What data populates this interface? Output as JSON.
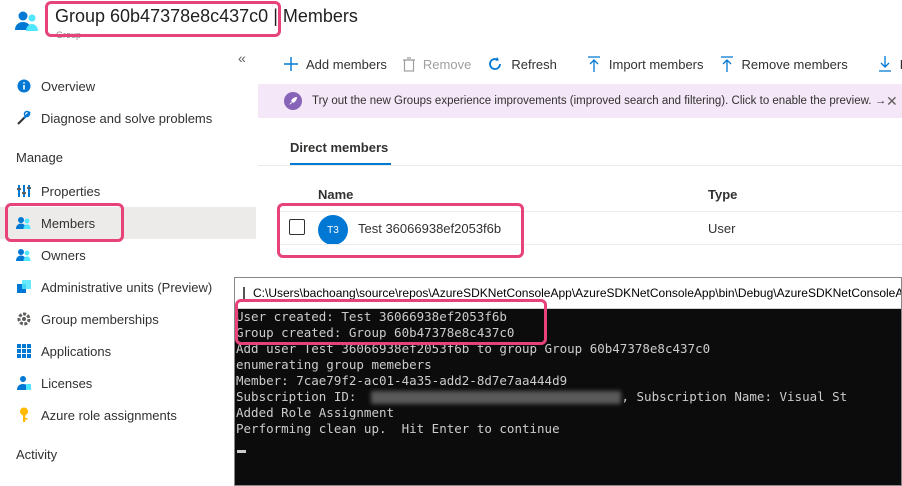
{
  "header": {
    "group_name": "Group 60b47378e8c437c0",
    "separator": "|",
    "page": "Members",
    "subtitle": "Group"
  },
  "sidebar": {
    "collapse_glyph": "«",
    "items": [
      {
        "label": "Overview",
        "icon": "info-icon"
      },
      {
        "label": "Diagnose and solve problems",
        "icon": "wrench-icon"
      }
    ],
    "manage_heading": "Manage",
    "manage_items": [
      {
        "label": "Properties",
        "icon": "properties-icon"
      },
      {
        "label": "Members",
        "icon": "members-icon",
        "active": true
      },
      {
        "label": "Owners",
        "icon": "owners-icon"
      },
      {
        "label": "Administrative units (Preview)",
        "icon": "admin-units-icon"
      },
      {
        "label": "Group memberships",
        "icon": "gear-icon"
      },
      {
        "label": "Applications",
        "icon": "grid-icon"
      },
      {
        "label": "Licenses",
        "icon": "license-icon"
      },
      {
        "label": "Azure role assignments",
        "icon": "key-icon"
      }
    ],
    "activity_heading": "Activity"
  },
  "toolbar": {
    "add": "Add members",
    "remove": "Remove",
    "refresh": "Refresh",
    "import": "Import members",
    "remove_members": "Remove members",
    "download": "D"
  },
  "banner": {
    "text": "Try out the new Groups experience improvements (improved search and filtering). Click to enable the preview. →",
    "close": "✕"
  },
  "tabs": {
    "direct": "Direct members"
  },
  "table": {
    "headers": {
      "name": "Name",
      "type": "Type"
    },
    "rows": [
      {
        "initials": "T3",
        "name": "Test 36066938ef2053f6b",
        "type": "User"
      }
    ]
  },
  "console": {
    "title": "C:\\Users\\bachoang\\source\\repos\\AzureSDKNetConsoleApp\\AzureSDKNetConsoleApp\\bin\\Debug\\AzureSDKNetConsoleA",
    "lines": {
      "l1": "User created: Test 36066938ef2053f6b",
      "l2": "Group created: Group 60b47378e8c437c0",
      "l3": "Add user Test 36066938ef2053f6b to group Group 60b47378e8c437c0",
      "l4": "enumerating group memebers",
      "l5": "Member: 7cae79f2-ac01-4a35-add2-8d7e7aa444d9",
      "l6a": "Subscription ID:  ",
      "l6b": ", Subscription Name: Visual St",
      "l7": "Added Role Assignment",
      "l8": "Performing clean up.  Hit Enter to continue"
    }
  },
  "colors": {
    "highlight": "#e7437a",
    "accent": "#0078d4",
    "banner_bg": "#f4e7f7",
    "console_bg": "#0c0c0c"
  }
}
